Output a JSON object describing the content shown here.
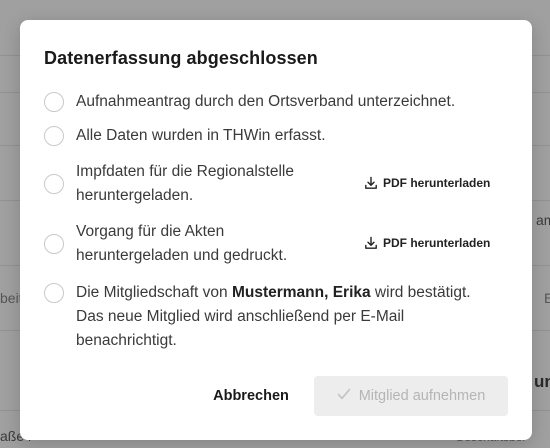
{
  "background": {
    "snippet_right_1": "am",
    "snippet_left": "beit",
    "snippet_right_2": "E",
    "snippet_right_bold": "un",
    "snippet_bottom_left": "aße ľ",
    "snippet_bottom_right": "Geschäftsber"
  },
  "modal": {
    "title": "Datenerfassung abgeschlossen",
    "items": [
      {
        "label": "Aufnahmeantrag durch den Ortsverband unterzeichnet."
      },
      {
        "label": "Alle Daten wurden in THWin erfasst."
      },
      {
        "label_line1": "Impfdaten für die Regionalstelle",
        "label_line2": "heruntergeladen.",
        "pdf_label": "PDF herunterladen"
      },
      {
        "label_line1": "Vorgang für die Akten",
        "label_line2": "heruntergeladen und gedruckt.",
        "pdf_label": "PDF herunterladen"
      },
      {
        "label_pre": "Die Mitgliedschaft von ",
        "member_name": "Mustermann, Erika",
        "label_post": " wird bestätigt.",
        "label_line2": "Das neue Mitglied wird anschließend per E-Mail",
        "label_line3": "benachrichtigt."
      }
    ],
    "cancel_label": "Abbrechen",
    "submit_label": "Mitglied aufnehmen",
    "submit_disabled": true
  },
  "colors": {
    "overlay": "#7a7a7a",
    "modal_bg": "#ffffff",
    "disabled_button_bg": "#ededed",
    "disabled_button_text": "#b5b5b5"
  }
}
